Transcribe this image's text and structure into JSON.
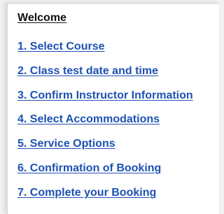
{
  "nav": {
    "title": "Welcome",
    "link_color": "#1d52b3",
    "steps": [
      {
        "label": "1. Select Course"
      },
      {
        "label": "2. Class test date and time"
      },
      {
        "label": "3. Confirm Instructor Information"
      },
      {
        "label": "4. Select Accommodations"
      },
      {
        "label": "5. Service Options"
      },
      {
        "label": "6. Confirmation of Booking"
      },
      {
        "label": "7. Complete your Booking"
      }
    ]
  }
}
